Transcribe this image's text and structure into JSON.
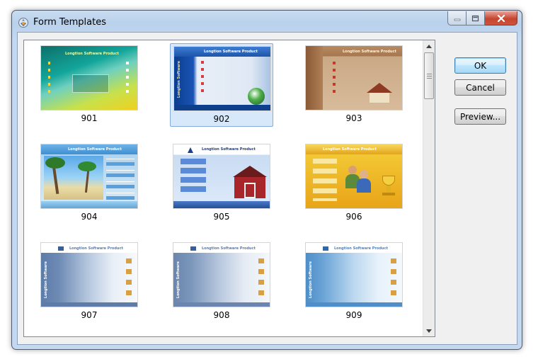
{
  "window": {
    "title": "Form Templates",
    "icon": "app-gear-icon"
  },
  "buttons": {
    "ok": "OK",
    "cancel": "Cancel",
    "preview": "Preview..."
  },
  "templates": [
    {
      "label": "901",
      "selected": false,
      "theme": "green-swirl"
    },
    {
      "label": "902",
      "selected": true,
      "theme": "blue-globe"
    },
    {
      "label": "903",
      "selected": false,
      "theme": "brown-house"
    },
    {
      "label": "904",
      "selected": false,
      "theme": "palm-beach"
    },
    {
      "label": "905",
      "selected": false,
      "theme": "red-barn"
    },
    {
      "label": "906",
      "selected": false,
      "theme": "gold-trophy"
    },
    {
      "label": "907",
      "selected": false,
      "theme": "gray-blue"
    },
    {
      "label": "908",
      "selected": false,
      "theme": "gray-blue"
    },
    {
      "label": "909",
      "selected": false,
      "theme": "light-blue"
    }
  ],
  "thumb_text": {
    "product": "Longtion Software Product",
    "side": "Longtion Software"
  },
  "colors": {
    "accent": "#3c7fb1",
    "selection": "#d7e8fb",
    "close": "#c6452f"
  }
}
